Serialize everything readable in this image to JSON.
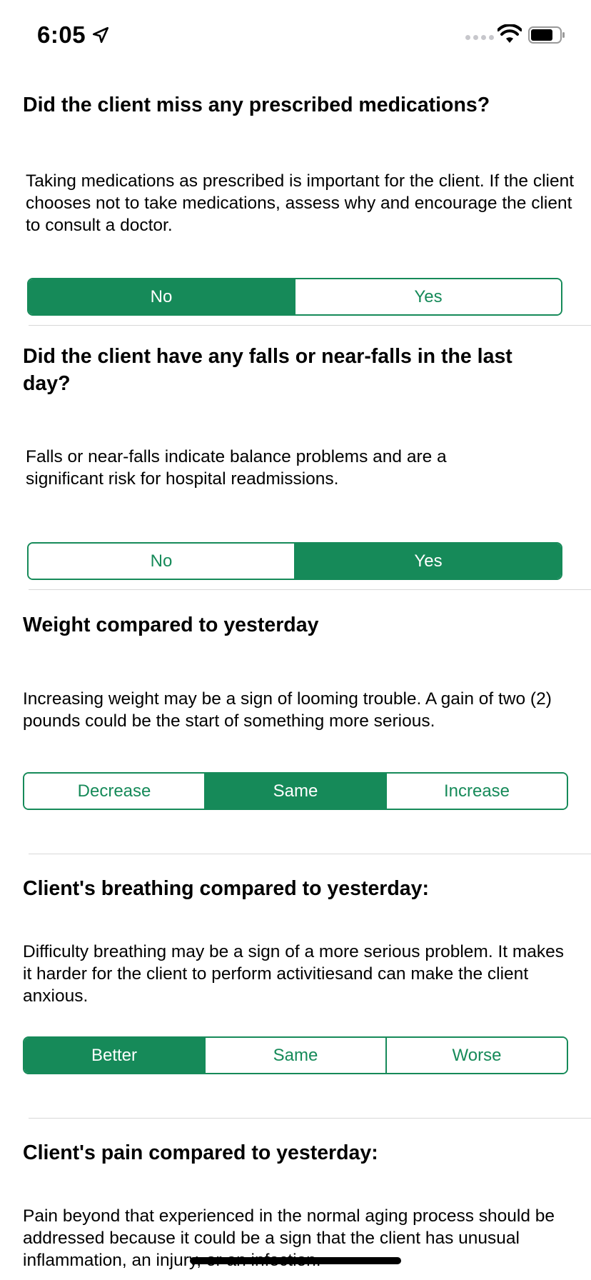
{
  "status_bar": {
    "time": "6:05"
  },
  "questions": [
    {
      "title": "Did the client miss any prescribed medications?",
      "description": "Taking medications as prescribed is important for the client. If the client chooses not to take medications, assess why and encourage the client to consult a doctor.",
      "options": [
        "No",
        "Yes"
      ],
      "selected": "No"
    },
    {
      "title": "Did the client have any falls or near-falls in the last day?",
      "description": "Falls or near-falls indicate balance problems and are a significant risk for hospital readmissions.",
      "options": [
        "No",
        "Yes"
      ],
      "selected": "Yes"
    },
    {
      "title": "Weight compared to yesterday",
      "description": "Increasing weight may be a sign of looming trouble. A gain of two (2) pounds could be the start of something more serious.",
      "options": [
        "Decrease",
        "Same",
        "Increase"
      ],
      "selected": "Same"
    },
    {
      "title": "Client's breathing compared to yesterday:",
      "description": "Difficulty breathing may be a sign of a more serious problem. It makes it harder for the client to perform activitiesand can make the client anxious.",
      "options": [
        "Better",
        "Same",
        "Worse"
      ],
      "selected": "Better"
    },
    {
      "title": "Client's pain compared to yesterday:",
      "description": "Pain beyond that experienced in the normal aging process should be addressed because it could be a sign that the client has unusual inflammation, an injury, or an infection."
    }
  ],
  "colors": {
    "accent": "#168a59",
    "divider": "#d8d8d8"
  }
}
